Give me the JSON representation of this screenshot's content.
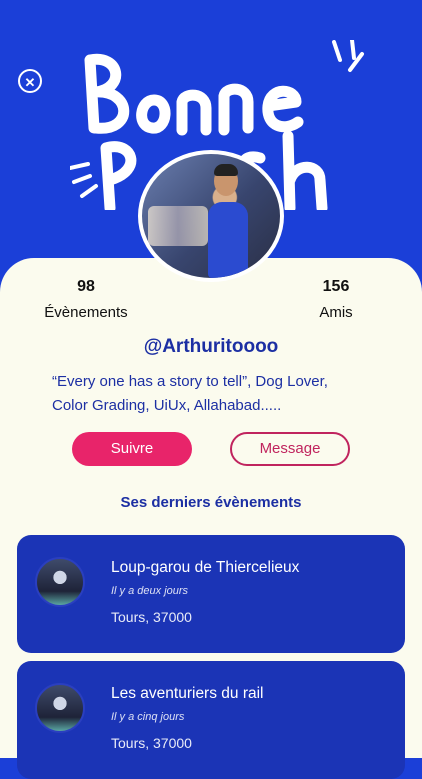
{
  "header": {
    "title": "Bonne Posh",
    "close_label": "✕"
  },
  "profile": {
    "events_count": "98",
    "events_label": "Évènements",
    "friends_count": "156",
    "friends_label": "Amis",
    "username": "@Arthuritoooo",
    "bio_line1": "“Every one has a story to tell”, Dog Lover,",
    "bio_line2": "Color Grading, UiUx, Allahabad....."
  },
  "actions": {
    "follow_label": "Suivre",
    "message_label": "Message"
  },
  "events_section": {
    "title": "Ses derniers évènements",
    "items": [
      {
        "title": "Loup-garou de Thiercelieux",
        "time": "Il y a deux jours",
        "location": "Tours, 37000"
      },
      {
        "title": "Les aventuriers du rail",
        "time": "Il y a cinq jours",
        "location": "Tours, 37000"
      }
    ]
  },
  "colors": {
    "hero_blue": "#1b3fd8",
    "card_bg": "#fbfbee",
    "accent_pink": "#e8246a",
    "event_blue": "#1b34b6",
    "text_blue": "#1c2fa3"
  }
}
